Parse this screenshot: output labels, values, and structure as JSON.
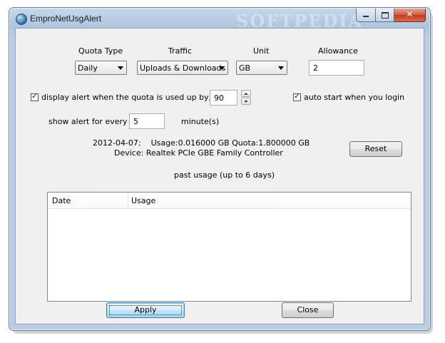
{
  "window": {
    "title": "EmproNetUsgAlert",
    "watermark": "SOFTPEDIA"
  },
  "settings": {
    "quota_type_label": "Quota Type",
    "quota_type_value": "Daily",
    "traffic_label": "Traffic",
    "traffic_value": "Uploads & Downloads",
    "unit_label": "Unit",
    "unit_value": "GB",
    "allowance_label": "Allowance",
    "allowance_value": "2"
  },
  "alert": {
    "display_alert_checked": true,
    "display_alert_label": "display alert when the quota is used up by, %",
    "percent_value": "90",
    "auto_start_checked": true,
    "auto_start_label": "auto start when you login",
    "show_every_label": "show alert for every",
    "interval_value": "5",
    "interval_unit": "minute(s)"
  },
  "status": {
    "line1": "2012-04-07:    Usage:0.016000 GB Quota:1.800000 GB",
    "line2": "Device: Realtek PCIe GBE Family Controller",
    "reset_label": "Reset"
  },
  "history": {
    "title": "past usage (up to 6 days)",
    "columns": [
      "Date",
      "Usage"
    ],
    "rows": []
  },
  "buttons": {
    "apply": "Apply",
    "close": "Close"
  },
  "icons": {
    "app": "globe-icon",
    "minimize": "minimize-icon",
    "maximize": "maximize-icon",
    "close": "close-icon",
    "check": "✓",
    "close_glyph": "✕"
  }
}
